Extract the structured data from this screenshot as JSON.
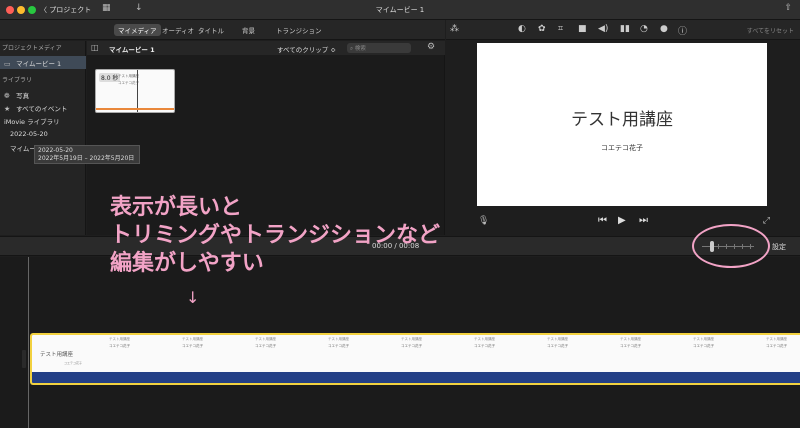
{
  "titlebar": {
    "back_label": "〈 プロジェクト",
    "window_title": "マイムービー 1",
    "icons": [
      "movie-settings-icon",
      "import-icon",
      "share-icon"
    ]
  },
  "tabs": [
    {
      "label": "マイメディア",
      "active": true
    },
    {
      "label": "オーディオ",
      "active": false
    },
    {
      "label": "タイトル",
      "active": false
    },
    {
      "label": "背景",
      "active": false
    },
    {
      "label": "トランジション",
      "active": false
    }
  ],
  "viewer_toolbar": {
    "icons": [
      "magic-wand-icon",
      "color-balance-icon",
      "color-palette-icon",
      "crop-icon",
      "camera-icon",
      "volume-icon",
      "equalizer-icon",
      "speed-icon",
      "filter-icon",
      "info-icon"
    ],
    "reset_all": "すべてをリセット"
  },
  "sidebar": {
    "project_media_header": "プロジェクトメディア",
    "project_item": "マイムービー 1",
    "library_header": "ライブラリ",
    "photos": "写真",
    "all_events": "すべてのイベント",
    "imovie_library": "iMovie ライブラリ",
    "event_date": "2022-05-20",
    "project_partial": "マイムー"
  },
  "tooltip": {
    "line1": "2022-05-20",
    "line2": "2022年5月19日 – 2022年5月20日"
  },
  "browser": {
    "title": "マイムービー 1",
    "filter": "すべてのクリップ ≎",
    "search_placeholder": "検索",
    "clip": {
      "duration": "8.0 秒",
      "mini_line1": "テスト用講座",
      "mini_line2": "コエテコ花子"
    }
  },
  "viewer": {
    "slide_title": "テスト用講座",
    "slide_subtitle": "コエテコ花子"
  },
  "timeline": {
    "timecode": "00:00 / 00:08",
    "settings": "設定",
    "first_frame_title": "テスト用講座",
    "first_frame_sub": "コエテコ花子",
    "frame_line1": "テスト用講座",
    "frame_line2": "コエテコ花子"
  },
  "annotation": {
    "line1": "表示が長いと",
    "line2": "トリミングやトランジションなど",
    "line3": "編集がしやすい",
    "arrow": "↓",
    "color": "#f2a3c6"
  },
  "colors": {
    "clip_border": "#f2d13f",
    "audio_band": "#233f86",
    "selection": "#3f4a57"
  }
}
